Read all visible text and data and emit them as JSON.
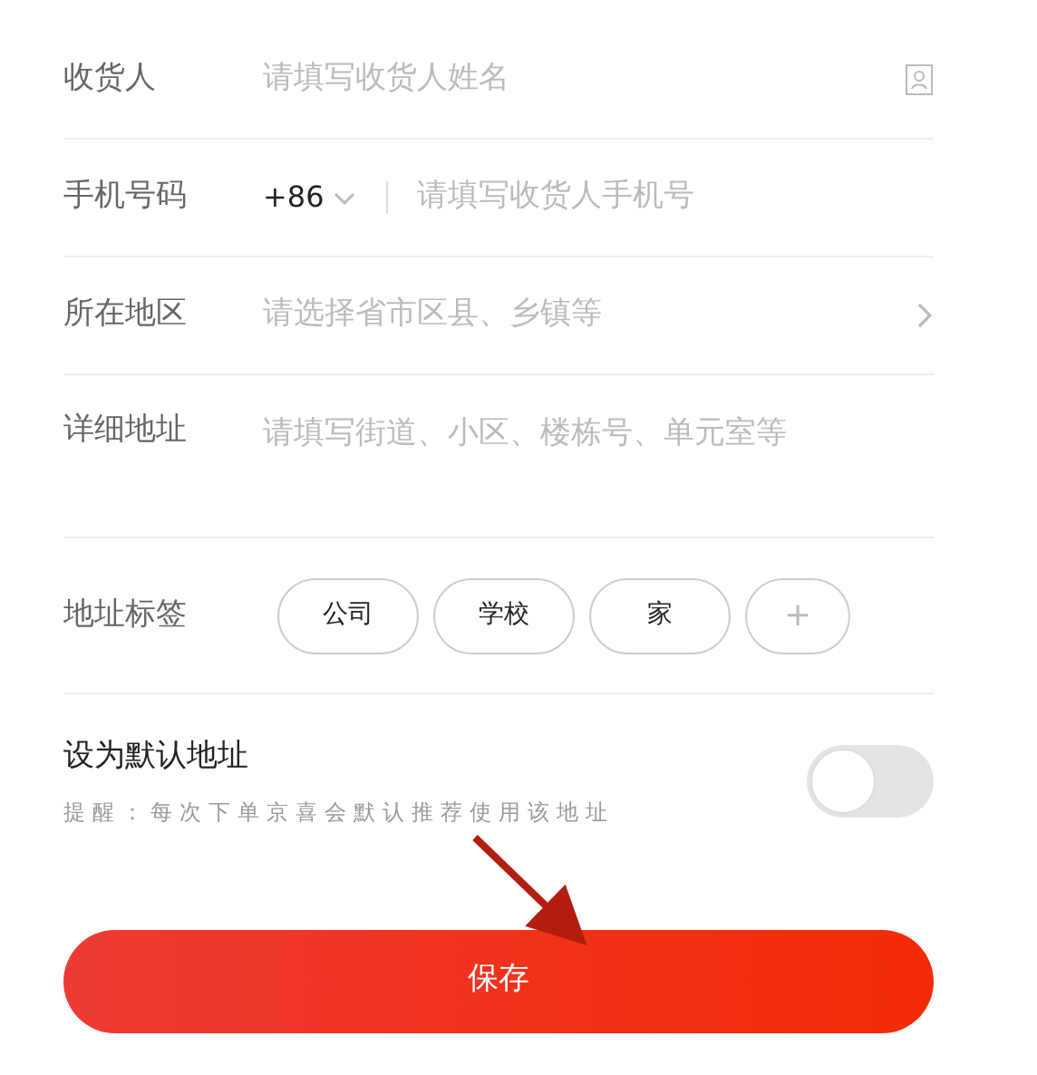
{
  "fields": [
    {
      "kind": "text",
      "label": "收货人",
      "placeholder": "请填写收货人姓名"
    },
    {
      "kind": "phone",
      "label": "手机号码",
      "code": "+86",
      "placeholder": "请填写收货人手机号"
    },
    {
      "kind": "select",
      "label": "所在地区",
      "placeholder": "请选择省市区县、乡镇等"
    },
    {
      "kind": "textarea",
      "label": "详细地址",
      "placeholder": "请填写街道、小区、楼栋号、单元室等"
    }
  ],
  "tags": {
    "label": "地址标签",
    "items": [
      {
        "kind": "tag",
        "text": "公司"
      },
      {
        "kind": "tag",
        "text": "学校"
      },
      {
        "kind": "tag",
        "text": "家"
      },
      {
        "kind": "add",
        "text": "+"
      }
    ]
  },
  "default_address": {
    "title": "设为默认地址",
    "hint": "提醒：每次下单京喜会默认推荐使用该地址",
    "on": false
  },
  "save_button": "保存"
}
